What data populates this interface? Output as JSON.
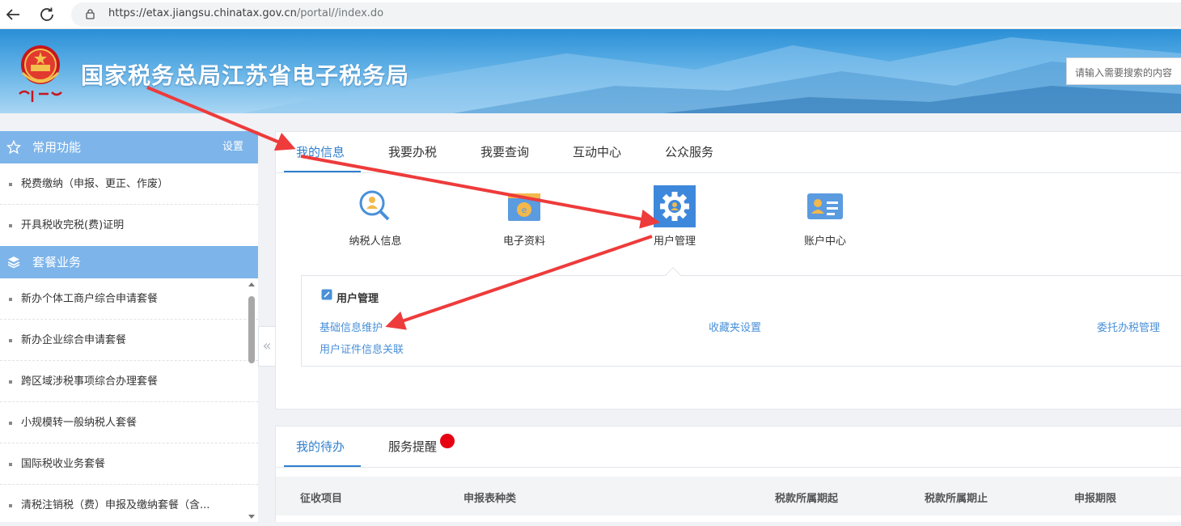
{
  "browser": {
    "url_main": "https://etax.jiangsu.chinatax.gov.cn",
    "url_rest": "/portal//index.do"
  },
  "header": {
    "site_title": "国家税务总局江苏省电子税务局",
    "search_placeholder": "请输入需要搜索的内容"
  },
  "sidebar": {
    "common_title": "常用功能",
    "setting_label": "设置",
    "common_items": [
      {
        "label": "税费缴纳（申报、更正、作废）"
      },
      {
        "label": "开具税收完税(费)证明"
      }
    ],
    "package_title": "套餐业务",
    "package_items": [
      {
        "label": "新办个体工商户综合申请套餐"
      },
      {
        "label": "新办企业综合申请套餐"
      },
      {
        "label": "跨区域涉税事项综合办理套餐"
      },
      {
        "label": "小规模转一般纳税人套餐"
      },
      {
        "label": "国际税收业务套餐"
      },
      {
        "label": "清税注销税（费）申报及缴纳套餐（含..."
      }
    ],
    "collapse_glyph": "«"
  },
  "main": {
    "tabs": [
      {
        "label": "我的信息"
      },
      {
        "label": "我要办税"
      },
      {
        "label": "我要查询"
      },
      {
        "label": "互动中心"
      },
      {
        "label": "公众服务"
      }
    ],
    "functions": [
      {
        "label": "纳税人信息",
        "icon": "taxpayer-info-icon"
      },
      {
        "label": "电子资料",
        "icon": "e-document-icon"
      },
      {
        "label": "用户管理",
        "icon": "gear-icon"
      },
      {
        "label": "账户中心",
        "icon": "account-card-icon"
      }
    ],
    "panel": {
      "title": "用户管理",
      "links": [
        {
          "label": "基础信息维护"
        },
        {
          "label": "收藏夹设置"
        },
        {
          "label": "委托办税管理"
        },
        {
          "label": "用户证件信息关联"
        }
      ]
    }
  },
  "todo": {
    "tabs": [
      {
        "label": "我的待办"
      },
      {
        "label": "服务提醒"
      }
    ],
    "columns": [
      {
        "label": "征收项目"
      },
      {
        "label": "申报表种类"
      },
      {
        "label": "税款所属期起"
      },
      {
        "label": "税款所属期止"
      },
      {
        "label": "申报期限"
      }
    ]
  },
  "colors": {
    "accent": "#2f7fce",
    "sidebar_header": "#7db4ea",
    "link": "#4a90d9",
    "annotation_arrow": "#ee3b3b",
    "badge": "#e60012"
  }
}
